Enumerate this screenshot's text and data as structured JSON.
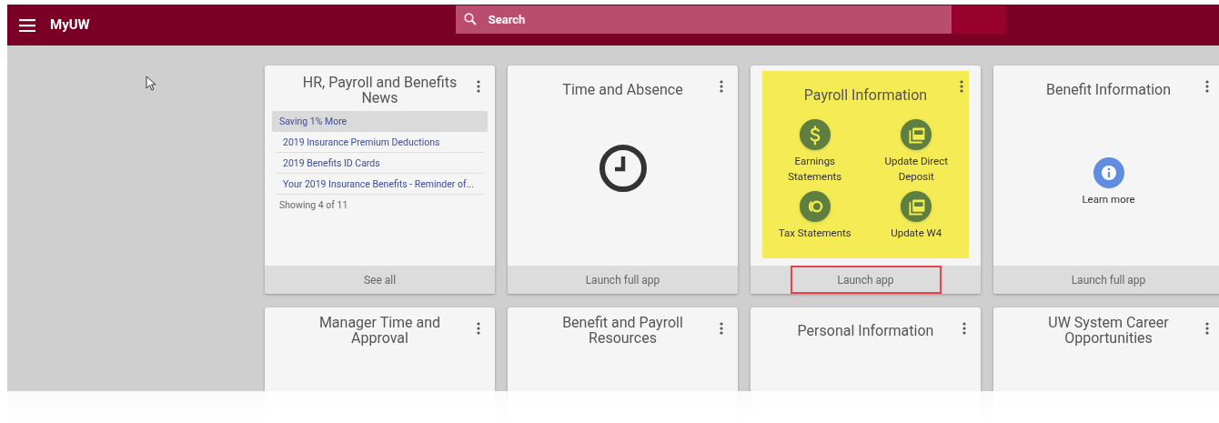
{
  "header": {
    "title": "MyUW",
    "search": {
      "placeholder": "Search"
    }
  },
  "cards": [
    {
      "kind": "news",
      "title": "HR, Payroll and Benefits News",
      "items": [
        {
          "label": "Saving 1% More",
          "selected": true
        },
        {
          "label": "2019 Insurance Premium Deductions",
          "selected": false
        },
        {
          "label": "2019 Benefits ID Cards",
          "selected": false
        },
        {
          "label": "Your 2019 Insurance Benefits - Reminder of...",
          "selected": false
        }
      ],
      "count": "Showing 4 of 11",
      "footer": {
        "label": "See all",
        "highlighted": false
      }
    },
    {
      "kind": "clock",
      "title": "Time and Absence",
      "footer": {
        "label": "Launch full app",
        "highlighted": false
      }
    },
    {
      "kind": "launcher",
      "title": "Payroll Information",
      "highlighted": true,
      "links": [
        {
          "kind": "dollar",
          "label": "Earnings Statements"
        },
        {
          "kind": "pdf",
          "label": "Update Direct Deposit"
        },
        {
          "kind": "ring",
          "label": "Tax Statements"
        },
        {
          "kind": "pdf",
          "label": "Update W4"
        }
      ],
      "footer": {
        "label": "Launch app",
        "highlighted": true
      }
    },
    {
      "kind": "info",
      "title": "Benefit Information",
      "action": "Learn more",
      "footer": {
        "label": "Launch full app",
        "highlighted": false
      }
    }
  ],
  "more_cards": [
    {
      "title": "Manager Time and Approval"
    },
    {
      "title": "Benefit and Payroll Resources"
    },
    {
      "title": "Personal Information"
    },
    {
      "title": "UW System Career Opportunities"
    }
  ]
}
